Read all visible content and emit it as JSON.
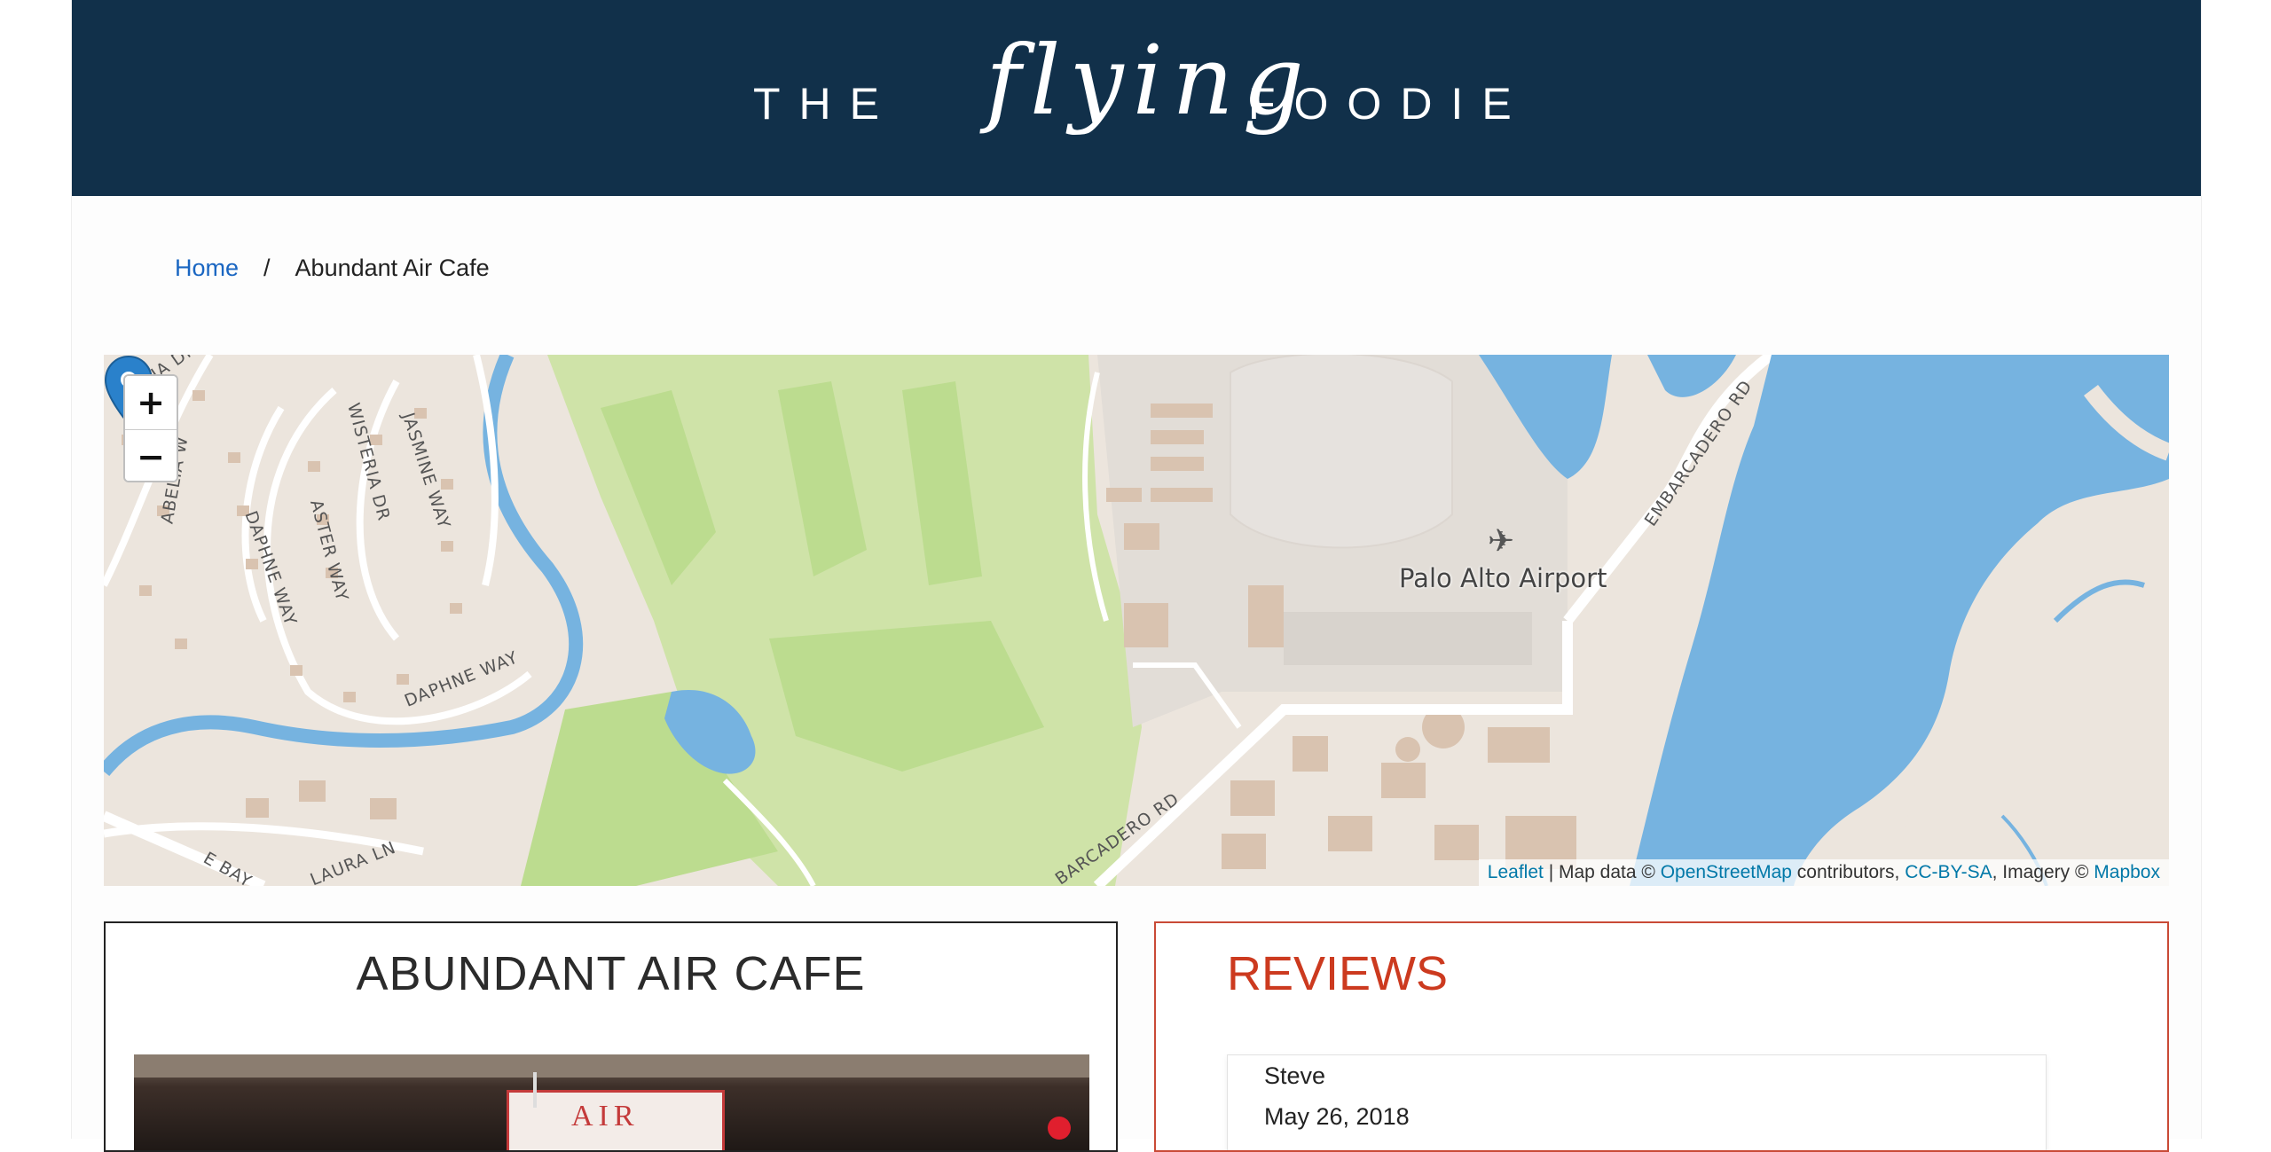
{
  "header": {
    "logo_the": "THE",
    "logo_script": "flying",
    "logo_foodie": "FOODIE"
  },
  "breadcrumb": {
    "home": "Home",
    "separator": "/",
    "current": "Abundant Air Cafe"
  },
  "map": {
    "zoom_in": "+",
    "zoom_out": "−",
    "airport_label": "Palo Alto Airport",
    "street_labels": [
      "ABELIA W",
      "DAPHNE WAY",
      "ASTER WAY",
      "WISTERIA DR",
      "JASMINE WAY",
      "DAPHNE WAY",
      "LAURA LN",
      "E BAY",
      "EMBARCADERO RD",
      "BARCADERO RD",
      "CA LIA DR"
    ],
    "attribution": {
      "leaflet": "Leaflet",
      "sep": " | Map data © ",
      "osm": "OpenStreetMap",
      "contributors": " contributors, ",
      "license": "CC-BY-SA",
      "imagery": ", Imagery © ",
      "mapbox": "Mapbox"
    },
    "colors": {
      "land": "#ece5dd",
      "water": "#76b3e0",
      "park": "#cfe3a8",
      "building": "#d9c3b0",
      "road": "#ffffff",
      "marker": "#2a81cb"
    }
  },
  "cafe": {
    "title": "ABUNDANT AIR CAFE",
    "photo_sign": "AIR"
  },
  "reviews": {
    "title": "REVIEWS",
    "items": [
      {
        "author": "Steve",
        "date": "May 26, 2018"
      }
    ]
  },
  "colors": {
    "header_bg": "#11304a",
    "link": "#1a66c2",
    "reviews_accent": "#cc3a1f"
  }
}
